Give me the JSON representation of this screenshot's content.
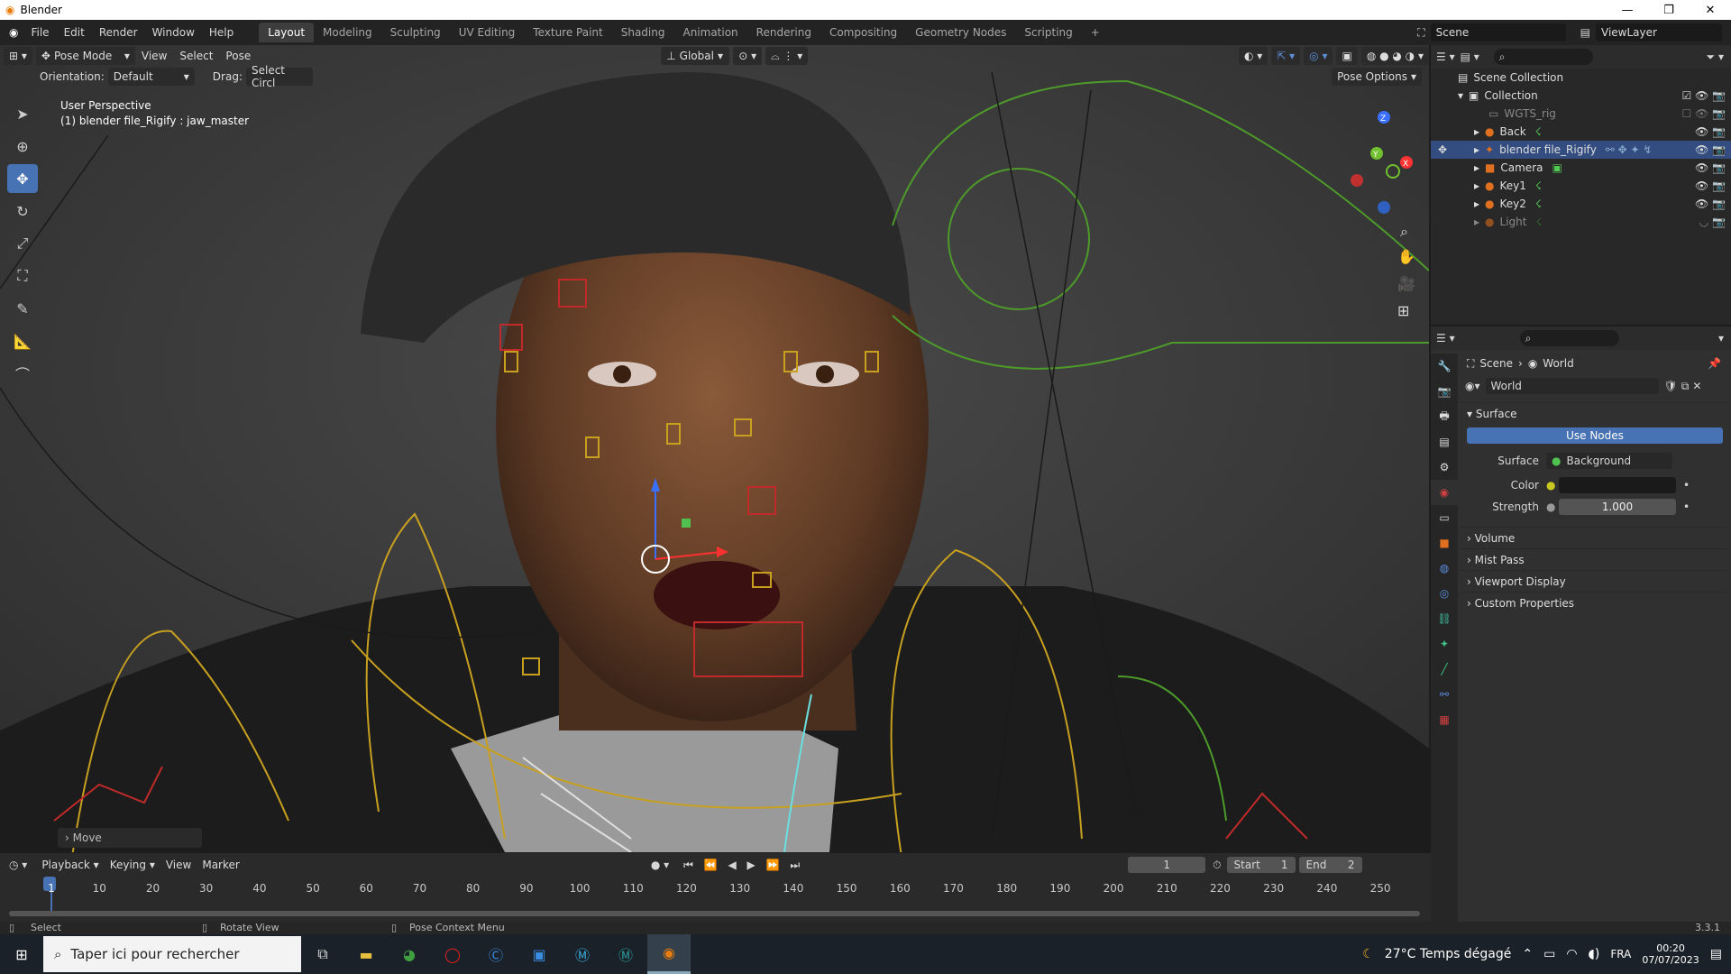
{
  "window": {
    "title": "Blender",
    "controls": [
      "—",
      "❐",
      "✕"
    ]
  },
  "menubar": {
    "items": [
      "File",
      "Edit",
      "Render",
      "Window",
      "Help"
    ]
  },
  "workspaces": {
    "tabs": [
      "Layout",
      "Modeling",
      "Sculpting",
      "UV Editing",
      "Texture Paint",
      "Shading",
      "Animation",
      "Rendering",
      "Compositing",
      "Geometry Nodes",
      "Scripting"
    ],
    "active": "Layout",
    "add": "+"
  },
  "scene": {
    "name": "Scene",
    "view_layer": "ViewLayer"
  },
  "viewport": {
    "mode": "Pose Mode",
    "menus": [
      "View",
      "Select",
      "Pose"
    ],
    "orientation_label": "Orientation:",
    "orientation_value": "Default",
    "drag_label": "Drag:",
    "drag_value": "Select Circl",
    "transform_space": "Global",
    "pose_options": "Pose Options",
    "overlay_title": "User Perspective",
    "overlay_subtitle": "(1) blender file_Rigify : jaw_master",
    "last_op": "Move",
    "gizmo": {
      "x": "X",
      "y": "Y",
      "z": "Z"
    }
  },
  "outliner": {
    "root": "Scene Collection",
    "collection": "Collection",
    "items": [
      {
        "name": "WGTS_rig",
        "dim": true
      },
      {
        "name": "Back",
        "dim": false
      },
      {
        "name": "blender file_Rigify",
        "dim": false,
        "selected": true
      },
      {
        "name": "Camera",
        "dim": false
      },
      {
        "name": "Key1",
        "dim": false
      },
      {
        "name": "Key2",
        "dim": false
      },
      {
        "name": "Light",
        "dim": true
      }
    ]
  },
  "properties": {
    "breadcrumb": [
      "Scene",
      "World"
    ],
    "datablock": "World",
    "surface_section": "Surface",
    "use_nodes": "Use Nodes",
    "surface_label": "Surface",
    "surface_value": "Background",
    "color_label": "Color",
    "strength_label": "Strength",
    "strength_value": "1.000",
    "sections": [
      "Volume",
      "Mist Pass",
      "Viewport Display",
      "Custom Properties"
    ]
  },
  "timeline": {
    "menus": [
      "Playback",
      "Keying",
      "View",
      "Marker"
    ],
    "current_frame": "1",
    "start_label": "Start",
    "start_value": "1",
    "end_label": "End",
    "end_value": "2",
    "ticks": [
      "1",
      "10",
      "20",
      "30",
      "40",
      "50",
      "60",
      "70",
      "80",
      "90",
      "100",
      "110",
      "120",
      "130",
      "140",
      "150",
      "160",
      "170",
      "180",
      "190",
      "200",
      "210",
      "220",
      "230",
      "240",
      "250"
    ]
  },
  "statusbar": {
    "select": "Select",
    "rotate": "Rotate View",
    "context": "Pose Context Menu",
    "version": "3.3.1"
  },
  "taskbar": {
    "search_placeholder": "Taper ici pour rechercher",
    "weather": "27°C  Temps dégagé",
    "language": "FRA",
    "time": "00:20",
    "date": "07/07/2023"
  },
  "colors": {
    "accent": "#4772b3",
    "selected_row": "#334d80",
    "rig_yellow": "#c8a020",
    "rig_red": "#c02a2a",
    "rig_green": "#4d9a2a"
  }
}
